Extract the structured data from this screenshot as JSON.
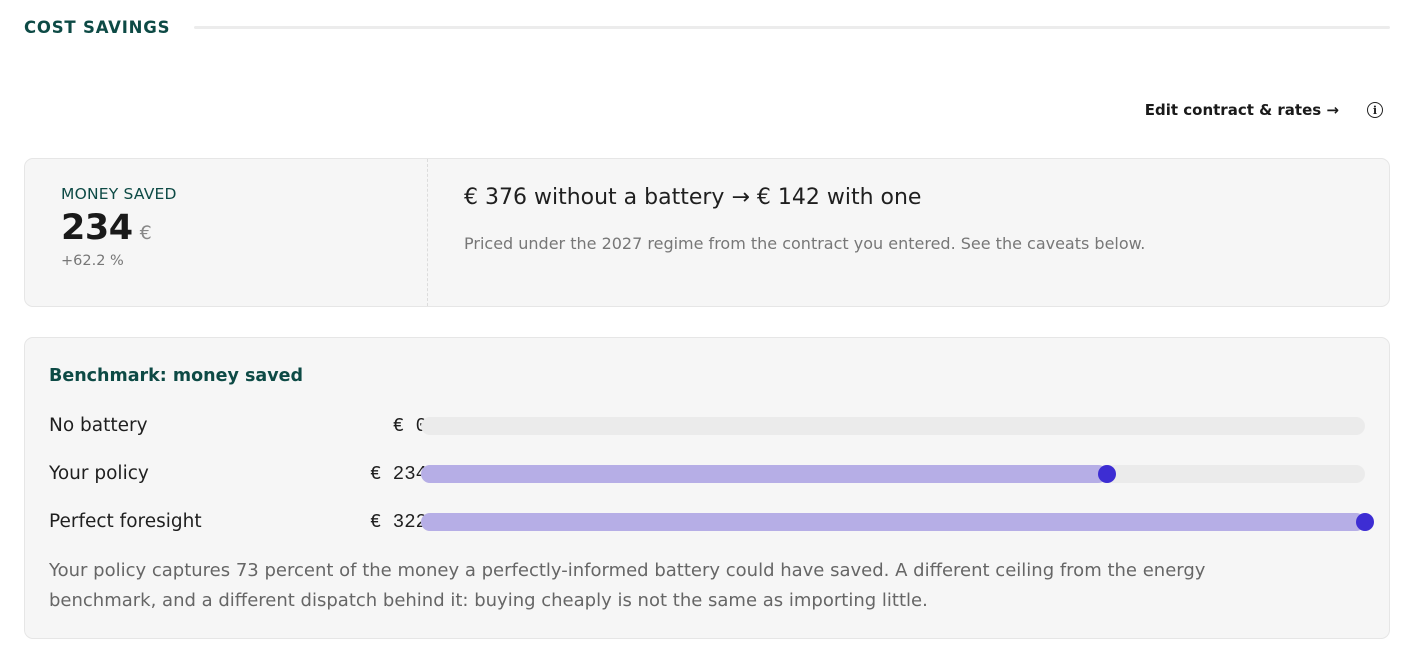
{
  "section": {
    "title": "COST SAVINGS"
  },
  "toolbar": {
    "edit_label": "Edit contract & rates →",
    "info_icon": "info-icon"
  },
  "summary": {
    "metric_label": "MONEY SAVED",
    "metric_value": "234",
    "metric_unit": "€",
    "metric_delta": "+62.2 %",
    "comparison": "€ 376 without a battery → € 142 with one",
    "caveat": "Priced under the 2027 regime from the contract you entered. See the caveats below."
  },
  "benchmark": {
    "title": "Benchmark: money saved",
    "max_value": 322,
    "rows": [
      {
        "label": "No battery",
        "value_text": "€ 0",
        "value": 0
      },
      {
        "label": "Your policy",
        "value_text": "€ 234",
        "value": 234
      },
      {
        "label": "Perfect foresight",
        "value_text": "€ 322",
        "value": 322
      }
    ],
    "note": "Your policy captures 73 percent of the money a perfectly-informed battery could have saved. A different ceiling from the energy benchmark, and a different dispatch behind it: buying cheaply is not the same as importing little."
  },
  "colors": {
    "accent": "#3d2dd3",
    "bar_fill": "#b6aee6",
    "track": "#ebebeb",
    "heading": "#0d4a45"
  }
}
